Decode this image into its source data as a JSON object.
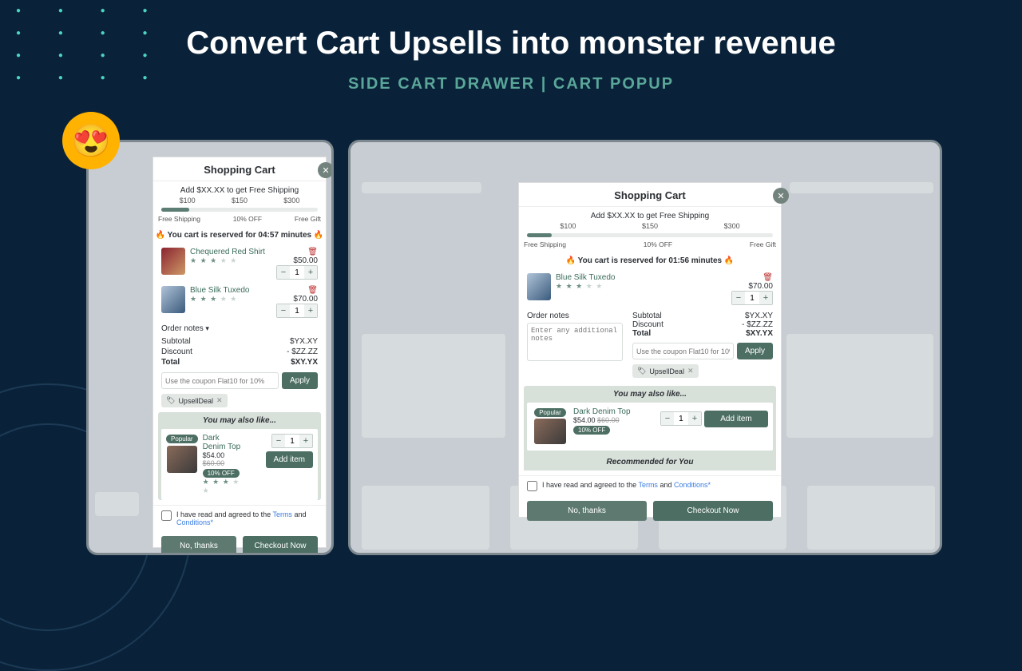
{
  "headline": "Convert Cart Upsells into monster revenue",
  "subhead": "SIDE CART DRAWER | CART POPUP",
  "cart": {
    "title": "Shopping Cart",
    "promo": "Add $XX.XX to get Free Shipping",
    "tiers": [
      "$100",
      "$150",
      "$300"
    ],
    "tierlabels": [
      "Free Shipping",
      "10% OFF",
      "Free Gift"
    ],
    "reserve_left": "🔥 You cart is reserved for 04:57 minutes 🔥",
    "reserve_right": "🔥 You cart is reserved for 01:56 minutes 🔥"
  },
  "items": {
    "red": {
      "name": "Chequered Red Shirt",
      "price": "$50.00",
      "qty": "1"
    },
    "blue": {
      "name": "Blue Silk Tuxedo",
      "price": "$70.00",
      "qty": "1"
    }
  },
  "notes": {
    "label": "Order notes",
    "placeholder": "Enter any additional notes"
  },
  "totals": {
    "sub_l": "Subtotal",
    "sub_v": "$YX.XY",
    "disc_l": "Discount",
    "disc_v": "- $ZZ.ZZ",
    "tot_l": "Total",
    "tot_v": "$XY.YX"
  },
  "coupon": {
    "placeholder": "Use the coupon Flat10 for 10%",
    "apply": "Apply",
    "tag": "UpsellDeal"
  },
  "upsell": {
    "head": "You may also like...",
    "rec": "Recommended for You",
    "badge_popular": "Popular",
    "badge_off": "10% OFF",
    "name": "Dark Denim Top",
    "price": "$54.00",
    "compare": "$60.00",
    "qty": "1",
    "add": "Add item"
  },
  "agree": {
    "pre": "I have read and agreed to the ",
    "terms": "Terms",
    "and": " and ",
    "cond": "Conditions*"
  },
  "actions": {
    "no": "No, thanks",
    "checkout": "Checkout Now"
  }
}
